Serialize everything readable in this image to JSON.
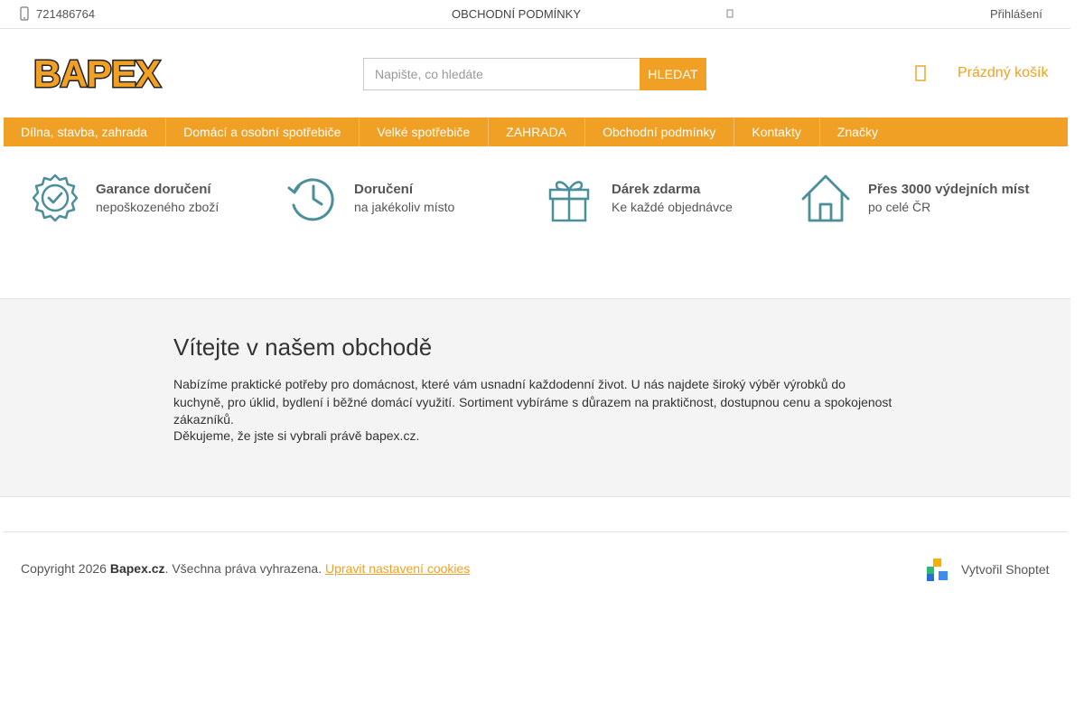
{
  "topbar": {
    "phone": "721486764",
    "terms": "OBCHODNÍ PODMÍNKY",
    "login": "Přihlášení"
  },
  "header": {
    "logo_text": "BAPEX",
    "search": {
      "placeholder": "Napište, co hledáte",
      "button": "HLEDAT"
    },
    "cart": {
      "label": "Prázdný košík",
      "icon": "cart-icon"
    }
  },
  "nav": {
    "items": [
      "Dílna, stavba, zahrada",
      "Domácí a osobní spotřebiče",
      "Velké spotřebiče",
      "ZAHRADA",
      "Obchodní podmínky",
      "Kontakty",
      "Značky"
    ]
  },
  "benefits": [
    {
      "title": "Garance doručení",
      "subtitle": "nepoškozeného zboží",
      "icon": "badge-check-icon"
    },
    {
      "title": "Doručení",
      "subtitle": "na jakékoliv místo",
      "icon": "clock-icon"
    },
    {
      "title": "Dárek zdarma",
      "subtitle": "Ke každé objednávce",
      "icon": "gift-icon"
    },
    {
      "title": "Přes 3000 výdejních míst",
      "subtitle": "po celé ČR",
      "icon": "house-icon"
    }
  ],
  "welcome": {
    "title": "Vítejte v našem obchodě",
    "paragraph": "Nabízíme praktické potřeby pro domácnost, které vám usnadní každodenní život. U nás najdete široký výběr výrobků do kuchyně, pro úklid, bydlení i běžné domácí využití. Sortiment vybíráme s důrazem na praktičnost, dostupnou cenu a spokojenost zákazníků.",
    "thanks": "Děkujeme, že jste si vybrali právě bapex.cz."
  },
  "footer": {
    "copyright_prefix": "Copyright 2026 ",
    "brand": "Bapex.cz",
    "rights": ". Všechna práva vyhrazena. ",
    "cookies_link": "Upravit nastavení cookies",
    "created_by": "Vytvořil Shoptet"
  },
  "colors": {
    "accent": "#f0a024",
    "icon_teal": "#4a8f99",
    "welcome_bg": "#f4f4f4"
  }
}
